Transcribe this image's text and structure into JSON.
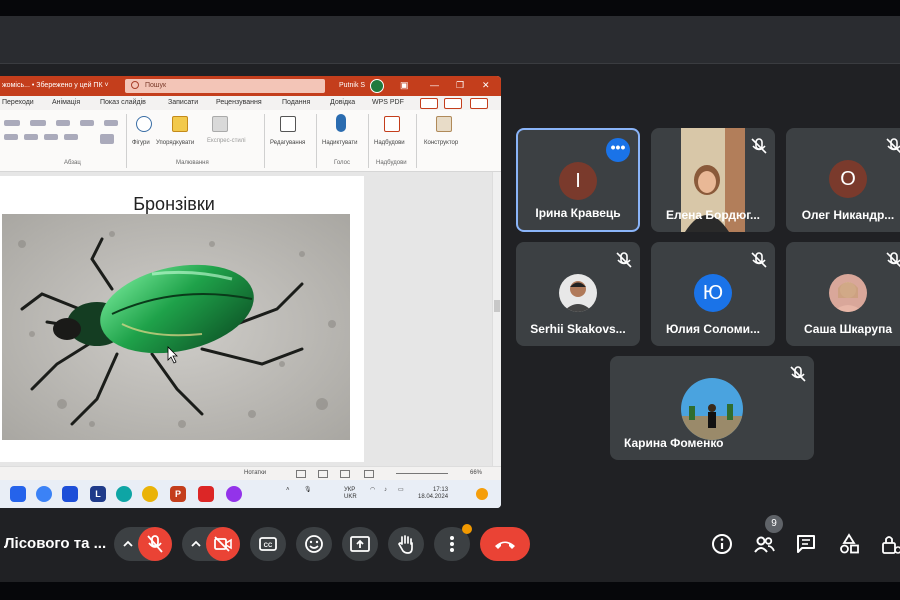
{
  "powerpoint": {
    "doc_title": "жомісь... • Збережено у цей ПК ˅",
    "search_placeholder": "Пошук",
    "user_name": "Putnik S",
    "menu_tabs": [
      "Переходи",
      "Анімація",
      "Показ слайдів",
      "Записати",
      "Рецензування",
      "Подання",
      "Довідка",
      "WPS PDF"
    ],
    "ribbon": {
      "group_labels": [
        "Абзац",
        "Малювання",
        "Голос",
        "Надбудови"
      ],
      "buttons": [
        "Фігури",
        "Упорядкувати",
        "Експрес-стилі",
        "Редагування",
        "Надиктувати",
        "Надбудови",
        "Конструктор"
      ]
    },
    "slide": {
      "title": "Бронзівки"
    },
    "status": {
      "notes": "Нотатки",
      "zoom": "66%"
    },
    "taskbar": {
      "lang_top": "УКР",
      "lang_bottom": "UKR",
      "time": "17:13",
      "date": "18.04.2024"
    }
  },
  "participants": [
    {
      "name": "Ірина Кравець",
      "initial": "І",
      "avatar_color": "#7a3a2c",
      "active": true
    },
    {
      "name": "Елена Бордюг...",
      "initial": "",
      "avatar_color": "",
      "active": false
    },
    {
      "name": "Олег Никандр...",
      "initial": "О",
      "avatar_color": "#7a3a2c",
      "active": false
    },
    {
      "name": "Serhii Skakovs...",
      "initial": "",
      "avatar_color": "",
      "active": false
    },
    {
      "name": "Юлия Соломи...",
      "initial": "Ю",
      "avatar_color": "#1a73e8",
      "active": false
    },
    {
      "name": "Саша Шкарупа",
      "initial": "",
      "avatar_color": "",
      "active": false
    },
    {
      "name": "Карина Фоменко",
      "initial": "",
      "avatar_color": "",
      "active": false
    }
  ],
  "meeting": {
    "name": "Лісового та ...",
    "participant_count": "9"
  },
  "colors": {
    "accent": "#8ab4f8",
    "danger": "#ea4335",
    "tile_bg": "#3c4043",
    "ppt_red": "#c43e1c"
  }
}
